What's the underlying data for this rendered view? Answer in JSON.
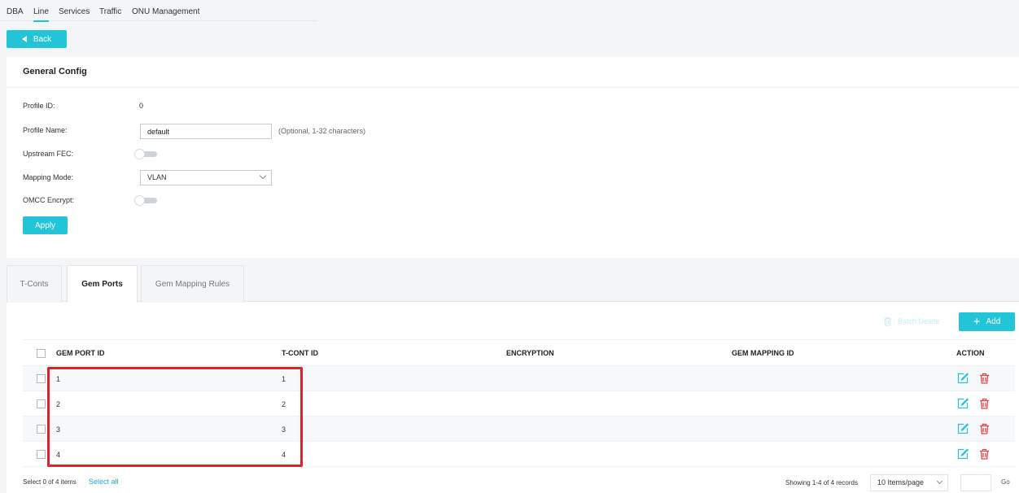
{
  "nav": {
    "tabs": [
      {
        "label": "DBA"
      },
      {
        "label": "Line"
      },
      {
        "label": "Services"
      },
      {
        "label": "Traffic"
      },
      {
        "label": "ONU Management"
      }
    ],
    "active_tab": "Line"
  },
  "back_label": "Back",
  "general_config": {
    "title": "General Config",
    "profile_id_label": "Profile ID:",
    "profile_id_value": "0",
    "profile_name_label": "Profile Name:",
    "profile_name_value": "default",
    "profile_name_hint": "(Optional, 1-32 characters)",
    "upstream_fec_label": "Upstream FEC:",
    "upstream_fec_on": false,
    "mapping_mode_label": "Mapping Mode:",
    "mapping_mode_value": "VLAN",
    "omcc_encrypt_label": "OMCC Encrypt:",
    "omcc_encrypt_on": false,
    "apply_label": "Apply"
  },
  "panel_tabs": [
    {
      "label": "T-Conts"
    },
    {
      "label": "Gem Ports"
    },
    {
      "label": "Gem Mapping Rules"
    }
  ],
  "active_panel_tab": "Gem Ports",
  "toolbar": {
    "batch_delete_label": "Batch Delete",
    "add_label": "Add"
  },
  "table": {
    "headers": [
      "GEM PORT ID",
      "T-CONT ID",
      "ENCRYPTION",
      "GEM MAPPING ID",
      "ACTION"
    ],
    "rows": [
      {
        "gem_port_id": "1",
        "tcont_id": "1",
        "encryption": "",
        "gem_mapping_id": ""
      },
      {
        "gem_port_id": "2",
        "tcont_id": "2",
        "encryption": "",
        "gem_mapping_id": ""
      },
      {
        "gem_port_id": "3",
        "tcont_id": "3",
        "encryption": "",
        "gem_mapping_id": ""
      },
      {
        "gem_port_id": "4",
        "tcont_id": "4",
        "encryption": "",
        "gem_mapping_id": ""
      }
    ]
  },
  "footer": {
    "selection_text": "Select 0 of 4 items",
    "select_all_label": "Select all",
    "showing_text": "Showing 1-4 of 4 records",
    "page_size": "10 Items/page",
    "go_label": "Go"
  },
  "colors": {
    "accent": "#22c5d8",
    "delete": "#e8414a",
    "highlight": "#e0202a"
  }
}
